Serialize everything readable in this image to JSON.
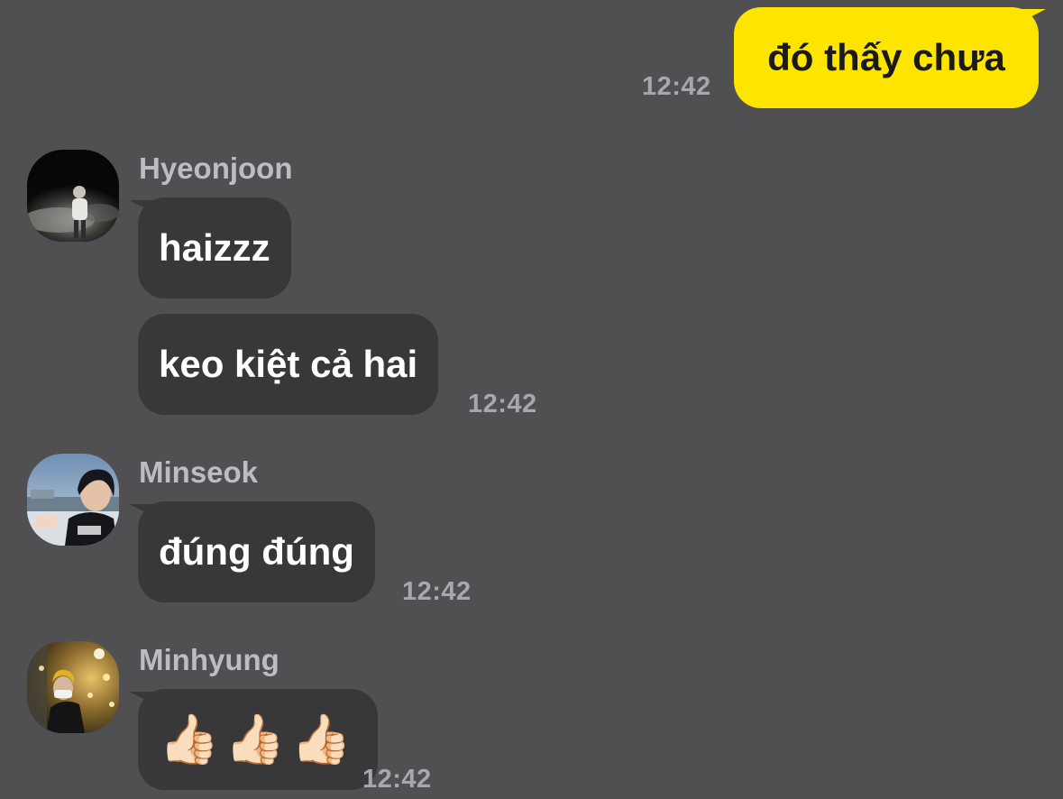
{
  "outgoing": {
    "text": "đó thấy chưa",
    "time": "12:42"
  },
  "groups": [
    {
      "sender": "Hyeonjoon",
      "avatar_icon": "person-night-photo-avatar",
      "messages": [
        "haizzz",
        "keo kiệt cả hai"
      ],
      "time": "12:42"
    },
    {
      "sender": "Minseok",
      "avatar_icon": "person-sea-photo-avatar",
      "messages": [
        "đúng đúng"
      ],
      "time": "12:42"
    },
    {
      "sender": "Minhyung",
      "avatar_icon": "person-lights-photo-avatar",
      "messages": [
        "👍🏻👍🏻👍🏻"
      ],
      "time": "12:42"
    }
  ],
  "colors": {
    "background": "#504f51",
    "outgoing_bubble": "#fee500",
    "incoming_bubble": "#383739"
  }
}
